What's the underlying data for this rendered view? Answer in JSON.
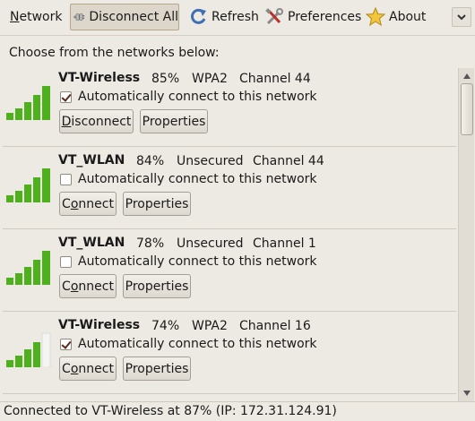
{
  "toolbar": {
    "network_label": "Network",
    "network_underline": "N",
    "network_rest": "etwork",
    "disconnect_all_label": "Disconnect All",
    "refresh_label": "Refresh",
    "preferences_label": "Preferences",
    "about_label": "About"
  },
  "prompt": "Choose from the networks below:",
  "networks": [
    {
      "name": "VT-Wireless",
      "signal": "85%",
      "security": "WPA2",
      "channel": "Channel 44",
      "auto_label": "Automatically connect to this network",
      "auto_checked": true,
      "action_label": "Disconnect",
      "action_underline": "D",
      "action_rest": "isconnect",
      "properties_label": "Properties",
      "bars_active": 5
    },
    {
      "name": "VT_WLAN",
      "signal": "84%",
      "security": "Unsecured",
      "channel": "Channel 44",
      "auto_label": "Automatically connect to this network",
      "auto_checked": false,
      "action_label": "Connect",
      "action_underline": "o",
      "properties_label": "Properties",
      "bars_active": 5
    },
    {
      "name": "VT_WLAN",
      "signal": "78%",
      "security": "Unsecured",
      "channel": "Channel 1",
      "auto_label": "Automatically connect to this network",
      "auto_checked": false,
      "action_label": "Connect",
      "action_underline": "o",
      "properties_label": "Properties",
      "bars_active": 5
    },
    {
      "name": "VT-Wireless",
      "signal": "74%",
      "security": "WPA2",
      "channel": "Channel 16",
      "auto_label": "Automatically connect to this network",
      "auto_checked": true,
      "action_label": "Connect",
      "action_underline": "o",
      "properties_label": "Properties",
      "bars_active": 4
    }
  ],
  "status": "Connected to VT-Wireless at 87% (IP: 172.31.124.91)",
  "colors": {
    "signal_active": "#4fb01e",
    "signal_inactive": "#f4f4f2"
  }
}
